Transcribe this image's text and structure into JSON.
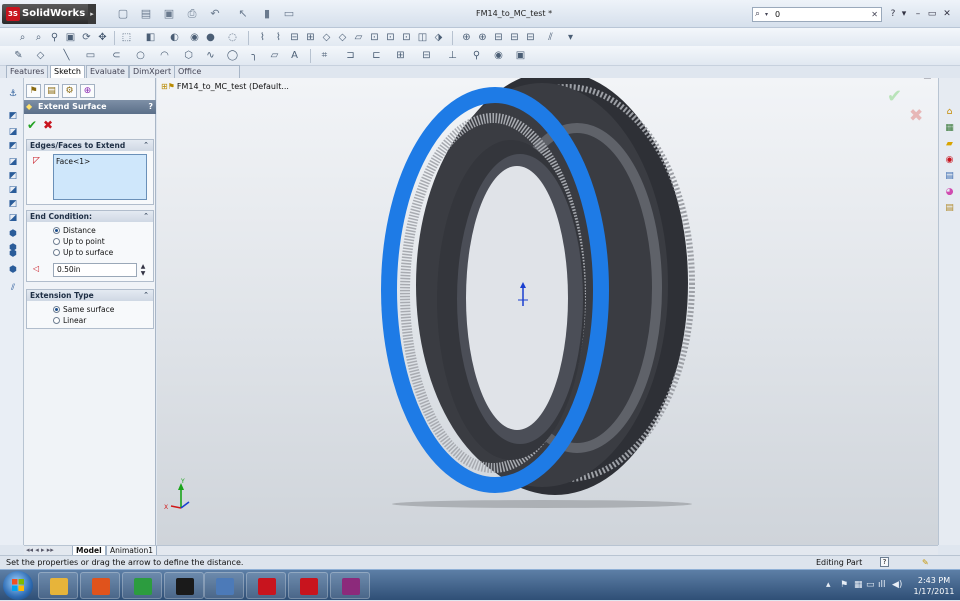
{
  "app": {
    "name": "SolidWorks",
    "doc_title": "FM14_to_MC_test *",
    "search_value": "0"
  },
  "tabs": [
    "Features",
    "Sketch",
    "Evaluate",
    "DimXpert",
    "Office Products"
  ],
  "active_tab": "Sketch",
  "property_manager": {
    "title": "Extend Surface",
    "help": "?",
    "edges_group": {
      "title": "Edges/Faces to Extend",
      "items": [
        "Face<1>"
      ]
    },
    "end_condition": {
      "title": "End Condition:",
      "options": [
        "Distance",
        "Up to point",
        "Up to surface"
      ],
      "selected": "Distance",
      "distance_value": "0.50in"
    },
    "extension_type": {
      "title": "Extension Type",
      "options": [
        "Same surface",
        "Linear"
      ],
      "selected": "Same surface"
    }
  },
  "viewport": {
    "tree_label": "FM14_to_MC_test  (Default..."
  },
  "bottom_tabs": [
    "Model",
    "Animation1"
  ],
  "status": {
    "message": "Set the properties or drag the arrow to define the distance.",
    "mode": "Editing Part",
    "help": "?"
  },
  "taskbar": {
    "time": "2:43 PM",
    "date": "1/17/2011",
    "apps": [
      {
        "name": "explorer",
        "color": "#e7b43a"
      },
      {
        "name": "media-player",
        "color": "#e0531c"
      },
      {
        "name": "chrome",
        "color": "#2c9c3f"
      },
      {
        "name": "command-prompt",
        "color": "#1a1a1a"
      },
      {
        "name": "network-tool",
        "color": "#4c7ab8"
      },
      {
        "name": "solidworks",
        "color": "#c8141e"
      },
      {
        "name": "solidworks-2",
        "color": "#c8141e"
      },
      {
        "name": "winrar",
        "color": "#8c2a7b"
      }
    ]
  },
  "colors": {
    "accent_face": "#1e7be6",
    "body_dark": "#2e3036",
    "brand_red": "#c8141e"
  }
}
